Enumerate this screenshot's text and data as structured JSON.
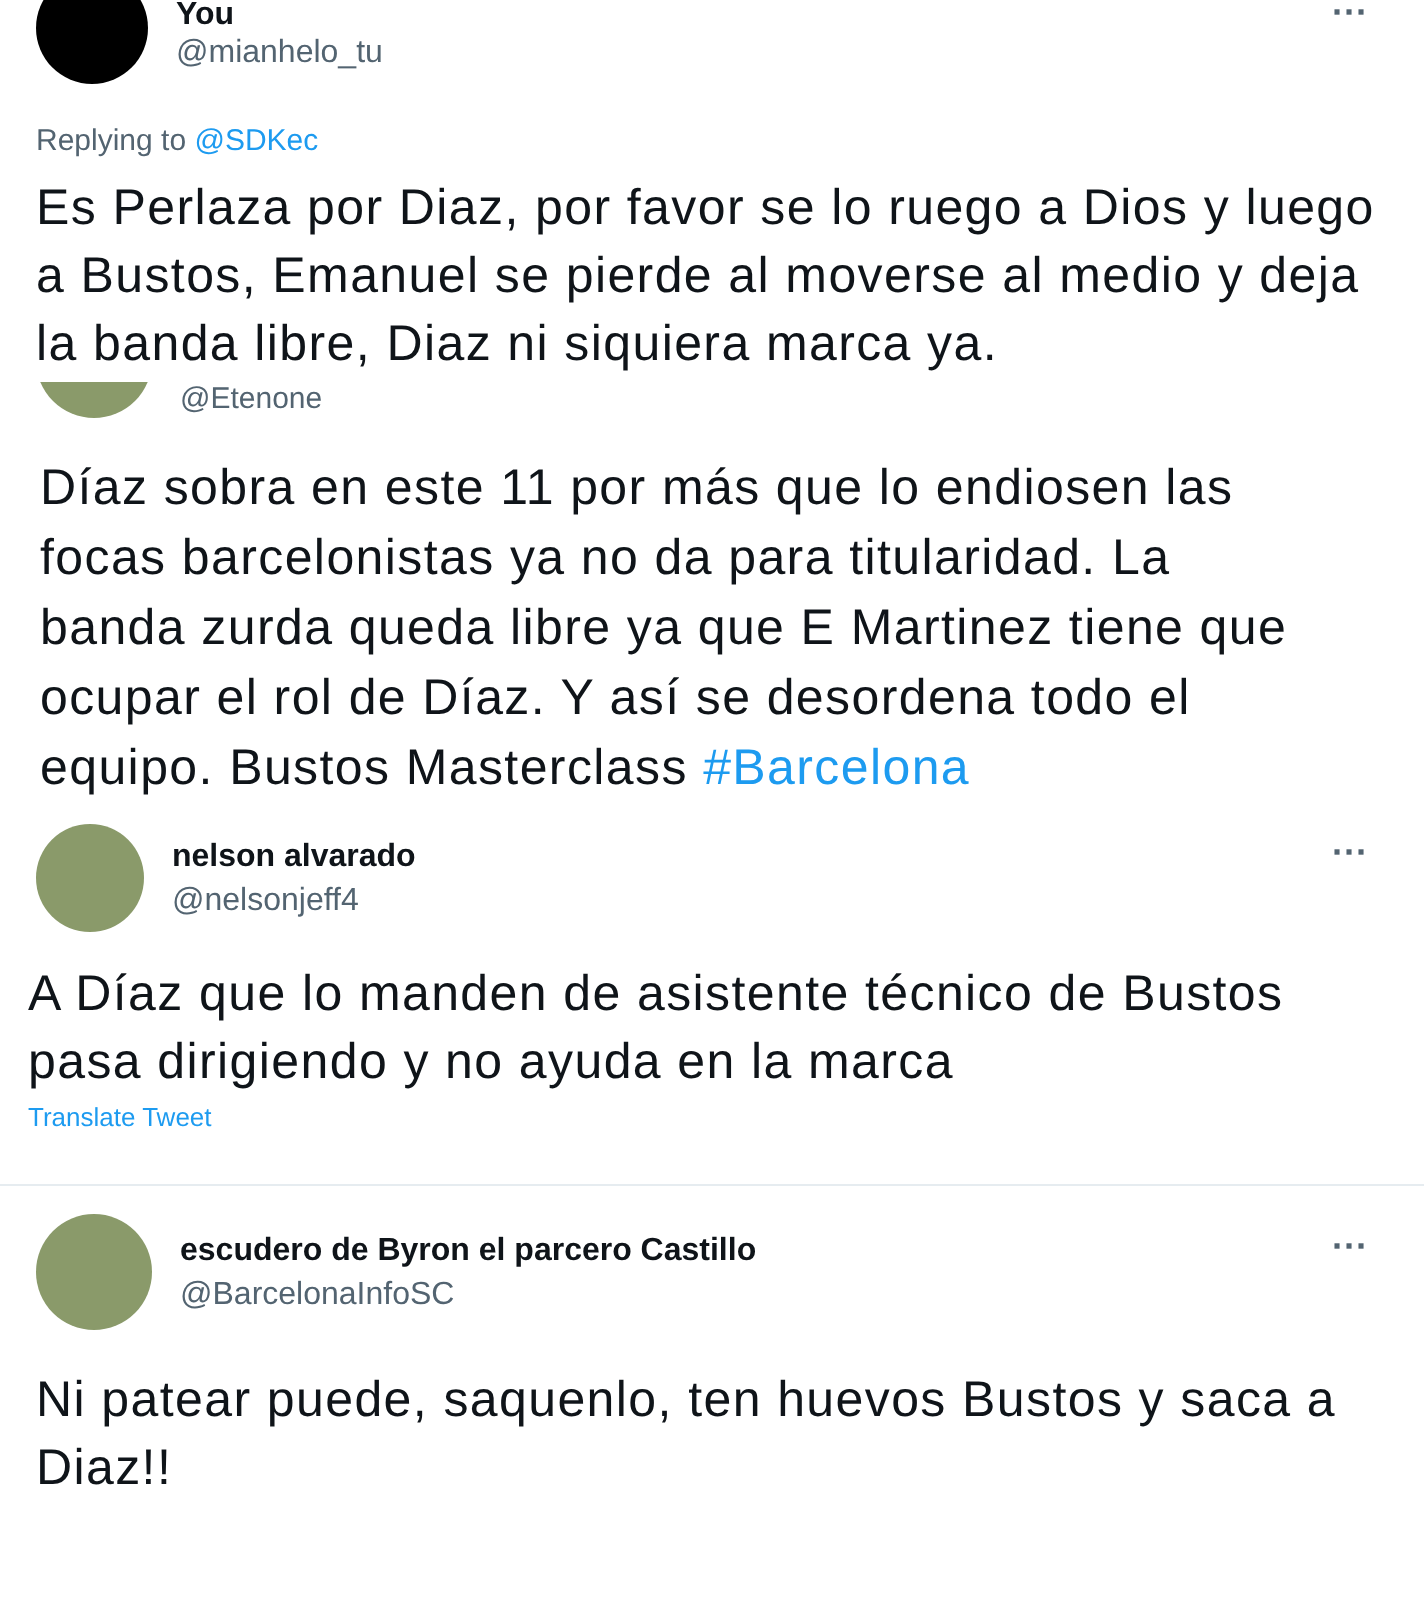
{
  "tweets": [
    {
      "name": "You",
      "handle": "@mianhelo_tu",
      "more": "···",
      "kind": "dark",
      "replying_label": "Replying to",
      "replying_to": "@SDKec",
      "text": "Es Perlaza por Diaz, por favor se lo ruego a Dios y luego a Bustos, Emanuel se pierde al moverse al medio y deja la banda libre, Diaz ni siquiera marca ya."
    },
    {
      "handle": "@Etenone",
      "kind": "photo",
      "text": "Díaz sobra en este 11 por más que lo endiosen las focas barcelonistas ya no da para titularidad. La banda zurda queda libre ya que E Martinez tiene que ocupar el rol de Díaz. Y así se desordena todo el equipo. Bustos Masterclass",
      "hashtag": "#Barcelona"
    },
    {
      "name": "nelson alvarado",
      "handle": "@nelsonjeff4",
      "more": "···",
      "kind": "photo",
      "text": "A Díaz que lo manden de asistente técnico de Bustos pasa dirigiendo y no ayuda en la marca",
      "translate": "Translate Tweet"
    },
    {
      "name": "escudero de Byron el parcero Castillo",
      "handle": "@BarcelonaInfoSC",
      "more": "···",
      "kind": "photo",
      "text": "Ni patear puede, saquenlo, ten huevos Bustos y saca a Diaz!!"
    }
  ]
}
